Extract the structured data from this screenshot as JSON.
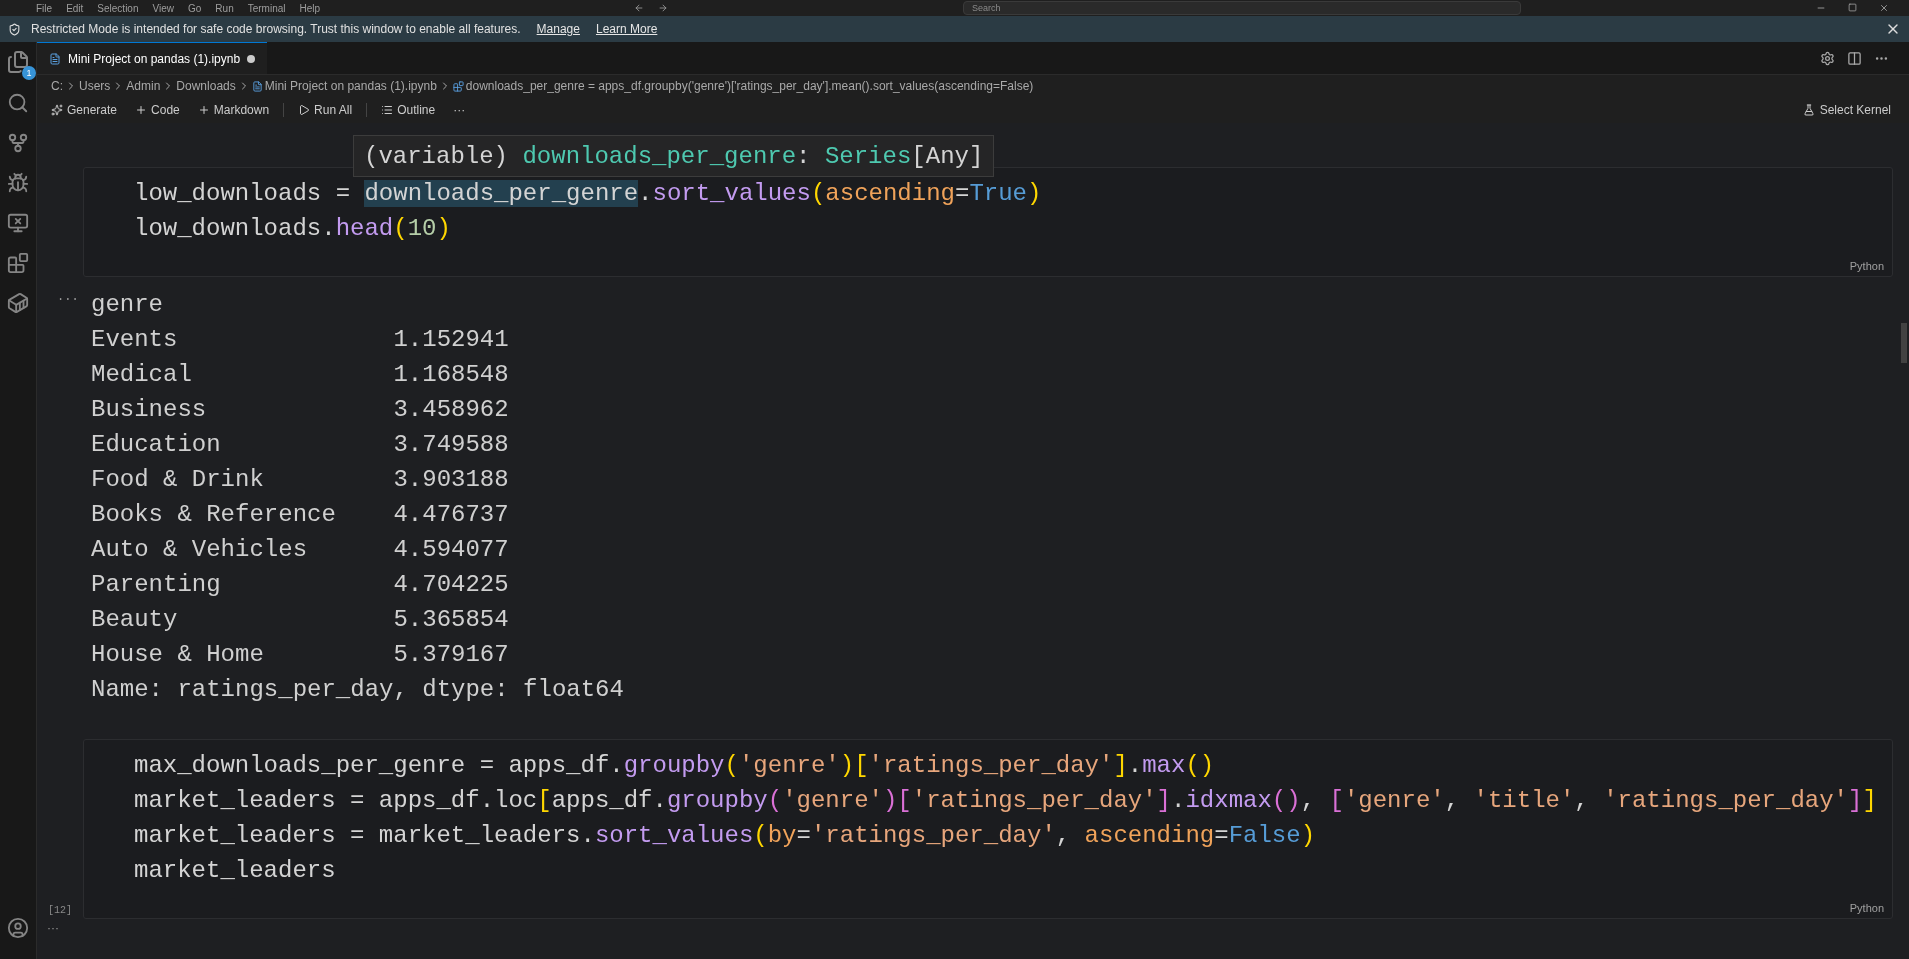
{
  "title_bar": {
    "menus": [
      "File",
      "Edit",
      "Selection",
      "View",
      "Go",
      "Run",
      "Terminal",
      "Help"
    ],
    "search": {
      "placeholder": "Search"
    }
  },
  "banner": {
    "text": "Restricted Mode is intended for safe code browsing. Trust this window to enable all features.",
    "links": [
      "Manage",
      "Learn More"
    ]
  },
  "activity_bar": {
    "badge": "1"
  },
  "tabs": [
    {
      "label": "Mini Project on pandas (1).ipynb",
      "selected": true,
      "modified": true
    }
  ],
  "breadcrumbs": [
    "C:",
    "Users",
    "Admin",
    "Downloads",
    "Mini Project on pandas (1).ipynb",
    "downloads_per_genre = apps_df.groupby('genre')['ratings_per_day'].mean().sort_values(ascending=False)"
  ],
  "toolbar": {
    "items": [
      {
        "label": "Generate",
        "kind": "sparkle"
      },
      {
        "label": "Code",
        "kind": "plus"
      },
      {
        "label": "Markdown",
        "kind": "plus"
      },
      {
        "label": "Run All",
        "kind": "run"
      },
      {
        "label": "Outline",
        "kind": "list"
      },
      {
        "label": "···",
        "kind": "more"
      }
    ],
    "kernel": "Select Kernel"
  },
  "tooltip": [
    {
      "t": "(variable) ",
      "kind": "plain"
    },
    {
      "t": "downloads_per_genre",
      "kind": "var"
    },
    {
      "t": ": ",
      "kind": "plain"
    },
    {
      "t": "Series",
      "kind": "var"
    },
    {
      "t": "[Any]",
      "kind": "plain"
    }
  ],
  "cells": [
    {
      "language": "Python",
      "lines": [
        [
          {
            "t": "low_downloads = ",
            "kind": "plain"
          },
          {
            "t": "downloads_per_genre",
            "kind": "hover"
          },
          {
            "t": ".",
            "kind": "plain"
          },
          {
            "t": "sort_values",
            "kind": "fn"
          },
          {
            "t": "(",
            "kind": "p1"
          },
          {
            "t": "ascending",
            "kind": "param"
          },
          {
            "t": "=",
            "kind": "plain"
          },
          {
            "t": "True",
            "kind": "kw"
          },
          {
            "t": ")",
            "kind": "p1"
          }
        ],
        [
          {
            "t": "low_downloads.",
            "kind": "plain"
          },
          {
            "t": "head",
            "kind": "fn"
          },
          {
            "t": "(",
            "kind": "p1"
          },
          {
            "t": "10",
            "kind": "num"
          },
          {
            "t": ")",
            "kind": "p1"
          }
        ]
      ],
      "output": {
        "marker": "···",
        "header": "genre",
        "rows": [
          {
            "label": "Events",
            "value": "1.152941"
          },
          {
            "label": "Medical",
            "value": "1.168548"
          },
          {
            "label": "Business",
            "value": "3.458962"
          },
          {
            "label": "Education",
            "value": "3.749588"
          },
          {
            "label": "Food & Drink",
            "value": "3.903188"
          },
          {
            "label": "Books & Reference",
            "value": "4.476737"
          },
          {
            "label": "Auto & Vehicles",
            "value": "4.594077"
          },
          {
            "label": "Parenting",
            "value": "4.704225"
          },
          {
            "label": "Beauty",
            "value": "5.365854"
          },
          {
            "label": "House & Home",
            "value": "5.379167"
          }
        ],
        "footer": "Name: ratings_per_day, dtype: float64"
      }
    },
    {
      "language": "Python",
      "execution_count": "[12]",
      "after_marker": "···",
      "lines": [
        [
          {
            "t": "max_downloads_per_genre = apps_df.",
            "kind": "plain"
          },
          {
            "t": "groupby",
            "kind": "fn"
          },
          {
            "t": "(",
            "kind": "p1"
          },
          {
            "t": "'genre'",
            "kind": "str"
          },
          {
            "t": ")",
            "kind": "p1"
          },
          {
            "t": "[",
            "kind": "p1"
          },
          {
            "t": "'ratings_per_day'",
            "kind": "str"
          },
          {
            "t": "]",
            "kind": "p1"
          },
          {
            "t": ".",
            "kind": "plain"
          },
          {
            "t": "max",
            "kind": "fn"
          },
          {
            "t": "()",
            "kind": "p1"
          }
        ],
        [
          {
            "t": "market_leaders = apps_df.loc",
            "kind": "plain"
          },
          {
            "t": "[",
            "kind": "p1"
          },
          {
            "t": "apps_df.",
            "kind": "plain"
          },
          {
            "t": "groupby",
            "kind": "fn"
          },
          {
            "t": "(",
            "kind": "p2"
          },
          {
            "t": "'genre'",
            "kind": "str"
          },
          {
            "t": ")",
            "kind": "p2"
          },
          {
            "t": "[",
            "kind": "p2"
          },
          {
            "t": "'ratings_per_day'",
            "kind": "str"
          },
          {
            "t": "]",
            "kind": "p2"
          },
          {
            "t": ".",
            "kind": "plain"
          },
          {
            "t": "idxmax",
            "kind": "fn"
          },
          {
            "t": "()",
            "kind": "p2"
          },
          {
            "t": ", ",
            "kind": "plain"
          },
          {
            "t": "[",
            "kind": "p2"
          },
          {
            "t": "'genre'",
            "kind": "str"
          },
          {
            "t": ", ",
            "kind": "plain"
          },
          {
            "t": "'title'",
            "kind": "str"
          },
          {
            "t": ", ",
            "kind": "plain"
          },
          {
            "t": "'ratings_per_day'",
            "kind": "str"
          },
          {
            "t": "]",
            "kind": "p2"
          },
          {
            "t": "]",
            "kind": "p1"
          }
        ],
        [
          {
            "t": "market_leaders = market_leaders.",
            "kind": "plain"
          },
          {
            "t": "sort_values",
            "kind": "fn"
          },
          {
            "t": "(",
            "kind": "p1"
          },
          {
            "t": "by",
            "kind": "param"
          },
          {
            "t": "=",
            "kind": "plain"
          },
          {
            "t": "'ratings_per_day'",
            "kind": "str"
          },
          {
            "t": ", ",
            "kind": "plain"
          },
          {
            "t": "ascending",
            "kind": "param"
          },
          {
            "t": "=",
            "kind": "plain"
          },
          {
            "t": "False",
            "kind": "kw"
          },
          {
            "t": ")",
            "kind": "p1"
          }
        ],
        [
          {
            "t": "market_leaders",
            "kind": "plain"
          }
        ]
      ]
    }
  ]
}
